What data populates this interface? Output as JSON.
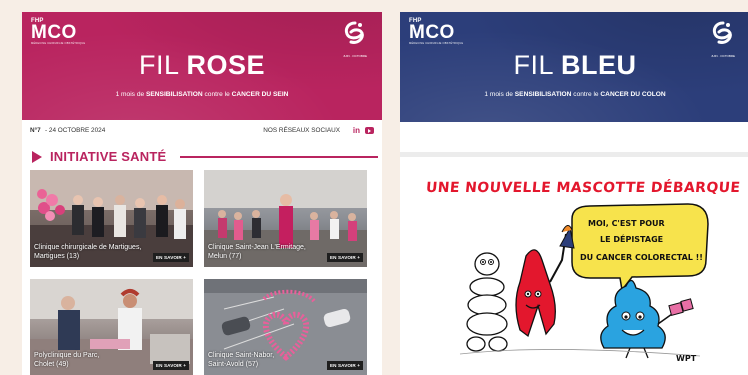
{
  "left_newsletter": {
    "logo": {
      "top": "FHP",
      "name": "MCO",
      "tagline": "Médecine Chirurgie Obstétrique"
    },
    "emblem_caption": "Juin · Octobre",
    "title_prefix": "FIL",
    "title_main": "ROSE",
    "subtitle": {
      "part1": "1 mois de ",
      "bold1": "SENSIBILISATION",
      "part2": " contre le ",
      "bold2": "CANCER DU SEIN"
    },
    "banner_color": "#b9245f",
    "issue_number": "N°7",
    "issue_date": "- 24 OCTOBRE 2024",
    "socials_label": "NOS RÉSEAUX SOCIAUX",
    "social_icons": [
      "linkedin-icon",
      "youtube-icon"
    ],
    "section_title": "INITIATIVE SANTÉ",
    "cards": [
      {
        "caption_line1": "Clinique chirurgicale de Martigues,",
        "caption_line2": "Martigues (13)",
        "more": "EN SAVOIR +"
      },
      {
        "caption_line1": "Clinique Saint-Jean L'Ermitage,",
        "caption_line2": "Melun (77)",
        "more": "EN SAVOIR +"
      },
      {
        "caption_line1": "Polyclinique du Parc,",
        "caption_line2": "Cholet (49)",
        "more": "EN SAVOIR +"
      },
      {
        "caption_line1": "Clinique Saint-Nabor,",
        "caption_line2": "Saint-Avold (57)",
        "more": "EN SAVOIR +"
      }
    ]
  },
  "right_newsletter": {
    "logo": {
      "top": "FHP",
      "name": "MCO",
      "tagline": "Médecine Chirurgie Obstétrique"
    },
    "emblem_caption": "Juin · Octobre",
    "title_prefix": "FIL",
    "title_main": "BLEU",
    "subtitle": {
      "part1": "1 mois de ",
      "bold1": "SENSIBILISATION",
      "part2": " contre le ",
      "bold2": "CANCER DU COLON"
    },
    "banner_color": "#2c3e7a",
    "cartoon": {
      "headline": "UNE NOUVELLE MASCOTTE DÉBARQUE",
      "bubble_line1": "MOI, C'EST POUR",
      "bubble_line2": "LE DÉPISTAGE",
      "bubble_line3": "DU CANCER COLORECTAL !!",
      "signature": "WPT"
    }
  }
}
